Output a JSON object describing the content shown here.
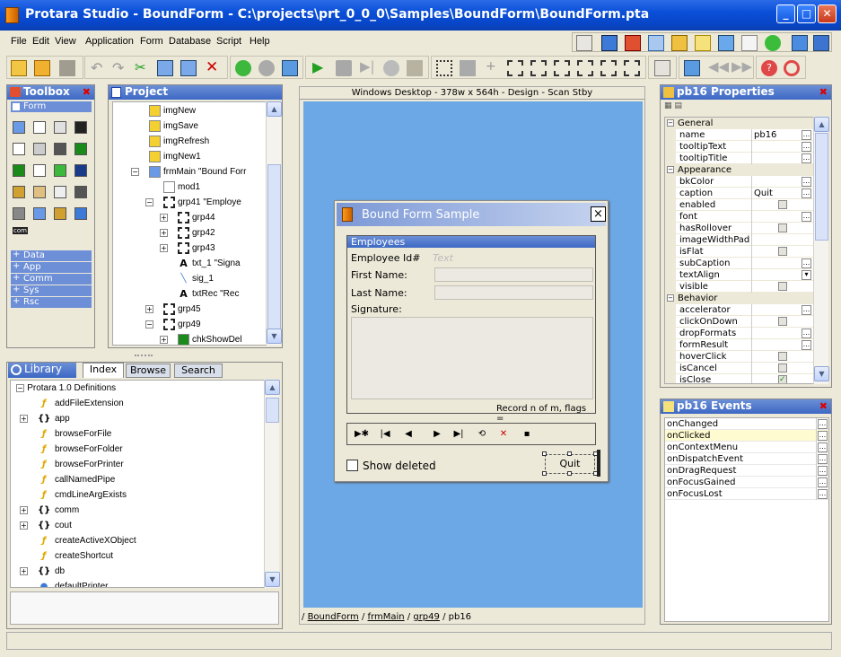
{
  "window": {
    "title": "Protara Studio - BoundForm - C:\\projects\\prt_0_0_0\\Samples\\BoundForm\\BoundForm.pta"
  },
  "menu": [
    "File",
    "Edit",
    "View",
    "Application",
    "Form",
    "Database",
    "Script",
    "Help"
  ],
  "toolbox": {
    "title": "Toolbox",
    "tab": "Form",
    "groups": [
      "Data",
      "App",
      "Comm",
      "Sys",
      "Rsc"
    ],
    "icon_text": "com"
  },
  "project": {
    "title": "Project",
    "items": [
      {
        "label": "imgNew",
        "indent": 40,
        "icon": "image-icon"
      },
      {
        "label": "imgSave",
        "indent": 40,
        "icon": "image-icon"
      },
      {
        "label": "imgRefresh",
        "indent": 40,
        "icon": "image-icon"
      },
      {
        "label": "imgNew1",
        "indent": 40,
        "icon": "image-icon"
      },
      {
        "label": "frmMain \"Bound Forr",
        "indent": 40,
        "icon": "form-icon",
        "exp": "-"
      },
      {
        "label": "mod1",
        "indent": 56,
        "icon": "module-icon"
      },
      {
        "label": "grp41 \"Employe",
        "indent": 56,
        "icon": "group-icon",
        "exp": "-"
      },
      {
        "label": "grp44",
        "indent": 72,
        "icon": "group-icon",
        "exp": "+"
      },
      {
        "label": "grp42",
        "indent": 72,
        "icon": "group-icon",
        "exp": "+"
      },
      {
        "label": "grp43",
        "indent": 72,
        "icon": "group-icon",
        "exp": "+"
      },
      {
        "label": "txt_1 \"Signa",
        "indent": 72,
        "icon": "text-icon"
      },
      {
        "label": "sig_1",
        "indent": 72,
        "icon": "signature-icon"
      },
      {
        "label": "txtRec \"Rec",
        "indent": 72,
        "icon": "text-icon"
      },
      {
        "label": "grp45",
        "indent": 56,
        "icon": "group-icon",
        "exp": "+"
      },
      {
        "label": "grp49",
        "indent": 56,
        "icon": "group-icon",
        "exp": "-"
      },
      {
        "label": "chkShowDel",
        "indent": 72,
        "icon": "checkbox-icon",
        "exp": "+"
      }
    ]
  },
  "library": {
    "tabs": [
      "Library",
      "Index",
      "Browse",
      "Search"
    ],
    "root": "Protara 1.0 Definitions",
    "items": [
      {
        "label": "addFileExtension",
        "kind": "f"
      },
      {
        "label": "app",
        "kind": "o"
      },
      {
        "label": "browseForFile",
        "kind": "f"
      },
      {
        "label": "browseForFolder",
        "kind": "f"
      },
      {
        "label": "browseForPrinter",
        "kind": "f"
      },
      {
        "label": "callNamedPipe",
        "kind": "f"
      },
      {
        "label": "cmdLineArgExists",
        "kind": "f"
      },
      {
        "label": "comm",
        "kind": "o"
      },
      {
        "label": "cout",
        "kind": "o"
      },
      {
        "label": "createActiveXObject",
        "kind": "f"
      },
      {
        "label": "createShortcut",
        "kind": "f"
      },
      {
        "label": "db",
        "kind": "o"
      },
      {
        "label": "defaultPrinter",
        "kind": "p"
      }
    ]
  },
  "designer": {
    "header": "Windows Desktop - 378w x 564h - Design - Scan Stby",
    "breadcrumb": [
      "BoundForm",
      "frmMain",
      "grp49",
      "pb16"
    ],
    "bc_sep": "/"
  },
  "form": {
    "title": "Bound Form Sample",
    "close": "×",
    "group_title": "Employees",
    "fields": {
      "empid_label": "Employee Id#",
      "empid_value": "Text",
      "first_label": "First Name:",
      "last_label": "Last Name:",
      "sig_label": "Signature:"
    },
    "record_text": "Record n of m, flags =",
    "checkbox_label": "Show deleted",
    "quit_label": "Quit",
    "nav": [
      "▶✱",
      "|◀",
      "◀",
      "▶",
      "▶|",
      "⟲",
      "✕",
      "▪"
    ]
  },
  "properties": {
    "title": "pb16 Properties",
    "rows": [
      {
        "type": "sec",
        "label": "General"
      },
      {
        "label": "name",
        "value": "pb16",
        "ctl": "dots"
      },
      {
        "label": "tooltipText",
        "value": "",
        "ctl": "dots"
      },
      {
        "label": "tooltipTitle",
        "value": "",
        "ctl": "dots"
      },
      {
        "type": "sec",
        "label": "Appearance"
      },
      {
        "label": "bkColor",
        "value": "",
        "ctl": "dots"
      },
      {
        "label": "caption",
        "value": "Quit",
        "ctl": "dots"
      },
      {
        "label": "enabled",
        "value": "",
        "ctl": "chk"
      },
      {
        "label": "font",
        "value": "",
        "ctl": "dots"
      },
      {
        "label": "hasRollover",
        "value": "",
        "ctl": "chk"
      },
      {
        "label": "imageWidthPad",
        "value": "",
        "ctl": ""
      },
      {
        "label": "isFlat",
        "value": "",
        "ctl": "chk"
      },
      {
        "label": "subCaption",
        "value": "",
        "ctl": "dots"
      },
      {
        "label": "textAlign",
        "value": "",
        "ctl": "drop"
      },
      {
        "label": "visible",
        "value": "",
        "ctl": "chk"
      },
      {
        "type": "sec",
        "label": "Behavior"
      },
      {
        "label": "accelerator",
        "value": "",
        "ctl": "dots"
      },
      {
        "label": "clickOnDown",
        "value": "",
        "ctl": "chk"
      },
      {
        "label": "dropFormats",
        "value": "",
        "ctl": "dots"
      },
      {
        "label": "formResult",
        "value": "",
        "ctl": "dots"
      },
      {
        "label": "hoverClick",
        "value": "",
        "ctl": "chk"
      },
      {
        "label": "isCancel",
        "value": "",
        "ctl": "chk"
      },
      {
        "label": "isClose",
        "value": "",
        "ctl": "chkg"
      }
    ]
  },
  "events": {
    "title": "pb16 Events",
    "rows": [
      "onChanged",
      "onClicked",
      "onContextMenu",
      "onDispatchEvent",
      "onDragRequest",
      "onFocusGained",
      "onFocusLost"
    ],
    "highlight": "onClicked"
  },
  "colors": {
    "title_bar": "#0a4fd8",
    "panel_header": "#3d68c4",
    "canvas": "#6da8e6",
    "highlight": "#fffbd0"
  }
}
